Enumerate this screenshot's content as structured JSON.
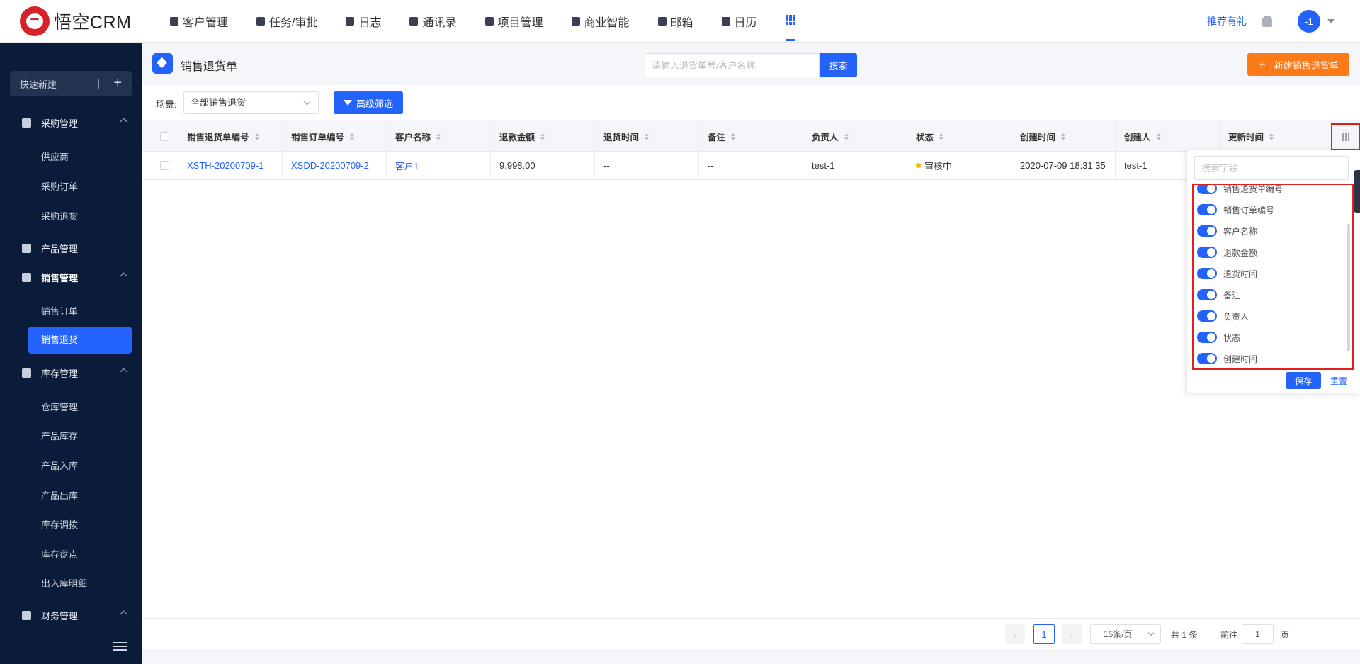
{
  "app": {
    "logo_text": "悟空CRM"
  },
  "nav": {
    "items": [
      "客户管理",
      "任务/审批",
      "日志",
      "通讯录",
      "项目管理",
      "商业智能",
      "邮箱",
      "日历"
    ],
    "recommend": "推荐有礼",
    "avatar": "-1"
  },
  "sidebar": {
    "quick_new": "快速新建",
    "groups": {
      "purchase": "采购管理",
      "product": "产品管理",
      "sales": "销售管理",
      "inventory": "库存管理",
      "finance": "财务管理"
    },
    "items": {
      "supplier": "供应商",
      "purchase_order": "采购订单",
      "purchase_return": "采购退货",
      "sales_order": "销售订单",
      "sales_return": "销售退货",
      "warehouse": "仓库管理",
      "stock": "产品库存",
      "stock_in": "产品入库",
      "stock_out": "产品出库",
      "transfer": "库存调拨",
      "check": "库存盘点",
      "detail": "出入库明细"
    }
  },
  "header": {
    "title": "销售退货单",
    "search_placeholder": "请输入退货单号/客户名称",
    "search_btn": "搜索",
    "new_btn": "新建销售退货单"
  },
  "filter": {
    "scene_label": "场景:",
    "scene_value": "全部销售退货",
    "advanced": "高级筛选"
  },
  "table": {
    "columns": [
      "销售退货单编号",
      "销售订单编号",
      "客户名称",
      "退款金额",
      "退货时间",
      "备注",
      "负责人",
      "状态",
      "创建时间",
      "创建人",
      "更新时间"
    ],
    "rows": [
      [
        "XSTH-20200709-1",
        "XSDD-20200709-2",
        "客户1",
        "9,998.00",
        "--",
        "--",
        "test-1",
        "审核中",
        "2020-07-09 18:31:35",
        "test-1",
        ""
      ]
    ]
  },
  "popover": {
    "search_placeholder": "搜索字段",
    "fields": [
      "销售退货单编号",
      "销售订单编号",
      "客户名称",
      "退款金额",
      "退货时间",
      "备注",
      "负责人",
      "状态",
      "创建时间"
    ],
    "save": "保存",
    "reset": "重置"
  },
  "pager": {
    "current": "1",
    "page_size": "15条/页",
    "total": "共 1 条",
    "goto": "前往",
    "goto_value": "1",
    "page_unit": "页"
  },
  "colors": {
    "accent": "#2362fb",
    "orange": "#fd7a18",
    "sidebar": "#0a1c3a",
    "status_pending": "#ffb900"
  }
}
